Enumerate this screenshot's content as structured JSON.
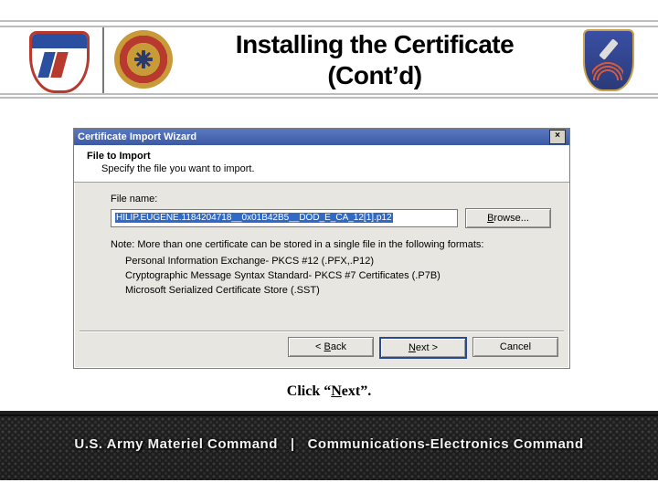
{
  "title_line1": "Installing the Certificate",
  "title_line2": "(Cont’d)",
  "wizard": {
    "window_title": "Certificate Import Wizard",
    "close_glyph": "×",
    "head_title": "File to Import",
    "head_sub": "Specify the file you want to import.",
    "file_label": "File name:",
    "file_value_prefix": "HILIP.EUGENE.1184204718__0x01B42B5__DOD_E_CA_12[1].p12",
    "browse_prefix": "B",
    "browse_rest": "rowse...",
    "note": "Note: More than one certificate can be stored in a single file in the following formats:",
    "fmt1": "Personal Information Exchange- PKCS #12 (.PFX,.P12)",
    "fmt2": "Cryptographic Message Syntax Standard- PKCS #7 Certificates (.P7B)",
    "fmt3": "Microsoft Serialized Certificate Store (.SST)",
    "back_pre": "< ",
    "back_u": "B",
    "back_rest": "ack",
    "next_u": "N",
    "next_rest": "ext >",
    "cancel": "Cancel"
  },
  "caption_pre": "Click “",
  "caption_u": "N",
  "caption_rest": "ext”.",
  "footer": {
    "left": "U.S. Army Materiel Command",
    "sep": "|",
    "right": "Communications-Electronics Command"
  }
}
